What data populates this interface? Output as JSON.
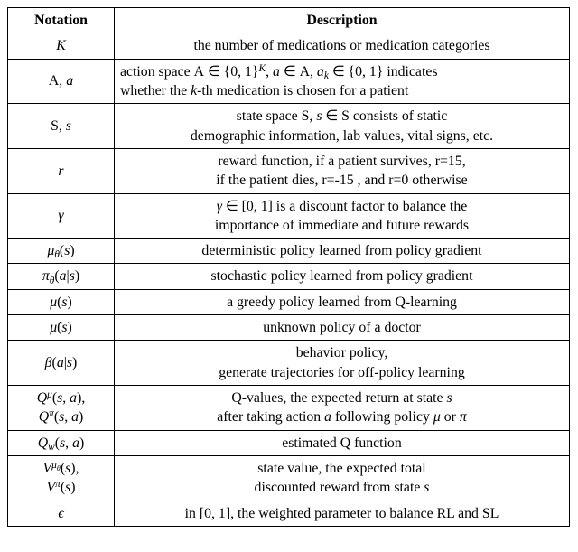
{
  "header": {
    "notation": "Notation",
    "description": "Description"
  },
  "rows": [
    {
      "notation_html": "K",
      "desc_lines": [
        "the number of medications or medication categories"
      ],
      "left": false
    },
    {
      "notation_html": "<span class='cal'>A</span><span class='upright'>, </span>a",
      "desc_lines": [
        "action space <span class='cal'>A</span> ∈ {0, 1}<span class='sup'>K</span>, <span style='font-style:italic'>a</span> ∈ <span class='cal'>A</span>, <span style='font-style:italic'>a<span class='sub'>k</span></span> ∈ {0, 1} indicates",
        "whether the <span style='font-style:italic'>k</span>-th medication is chosen for a patient"
      ],
      "left": true
    },
    {
      "notation_html": "<span class='cal'>S</span><span class='upright'>, </span>s",
      "desc_lines": [
        "state space <span class='cal'>S</span>, <span style='font-style:italic'>s</span> ∈ <span class='cal'>S</span> consists of static",
        "demographic information, lab values, vital signs, etc."
      ],
      "left": false
    },
    {
      "notation_html": "r",
      "desc_lines": [
        "reward function, if a patient survives, r=15,",
        "if the patient dies, r=-15 , and r=0 otherwise"
      ],
      "left": false
    },
    {
      "notation_html": "γ",
      "desc_lines": [
        "<span style='font-style:italic'>γ</span> ∈ [0, 1] is a discount factor to balance the",
        "importance of immediate and future rewards"
      ],
      "left": false
    },
    {
      "notation_html": "μ<span class='sub'>θ</span><span class='upright'>(</span>s<span class='upright'>)</span>",
      "desc_lines": [
        "deterministic policy learned from policy gradient"
      ],
      "left": false
    },
    {
      "notation_html": "π<span class='sub'>θ</span><span class='upright'>(</span>a<span class='upright'>|</span>s<span class='upright'>)</span>",
      "desc_lines": [
        "stochastic policy learned from policy gradient"
      ],
      "left": false
    },
    {
      "notation_html": "μ<span class='upright'>(</span>s<span class='upright'>)</span>",
      "desc_lines": [
        "a greedy policy learned from Q-learning"
      ],
      "left": false
    },
    {
      "notation_html": "μ̂<span class='upright'>(</span>s<span class='upright'>)</span>",
      "desc_lines": [
        "unknown policy of a doctor"
      ],
      "left": false
    },
    {
      "notation_html": "β<span class='upright'>(</span>a<span class='upright'>|</span>s<span class='upright'>)</span>",
      "desc_lines": [
        "behavior policy,",
        "generate trajectories for off-policy learning"
      ],
      "left": false
    },
    {
      "notation_html": "Q<span class='sup'>μ</span><span class='upright'>(</span>s<span class='upright'>, </span>a<span class='upright'>),</span><br>Q<span class='sup'>π</span><span class='upright'>(</span>s<span class='upright'>, </span>a<span class='upright'>)</span>",
      "desc_lines": [
        "Q-values, the expected return at state <span style='font-style:italic'>s</span>",
        "after taking action <span style='font-style:italic'>a</span> following policy <span style='font-style:italic'>μ</span> or <span style='font-style:italic'>π</span>"
      ],
      "left": false
    },
    {
      "notation_html": "Q<span class='sub'>w</span><span class='upright'>(</span>s<span class='upright'>, </span>a<span class='upright'>)</span>",
      "desc_lines": [
        "estimated Q function"
      ],
      "left": false
    },
    {
      "notation_html": "V<span class='sup'>μ<span class='sub' style='top:0.4em'>θ</span></span><span class='upright'>(</span>s<span class='upright'>),</span><br>V<span class='sup'>π</span><span class='upright'>(</span>s<span class='upright'>)</span>",
      "desc_lines": [
        "state value, the expected total",
        "discounted reward from state <span style='font-style:italic'>s</span>"
      ],
      "left": false
    },
    {
      "notation_html": "ϵ",
      "desc_lines": [
        "in [0, 1], the weighted parameter to balance RL and SL"
      ],
      "left": false
    }
  ]
}
